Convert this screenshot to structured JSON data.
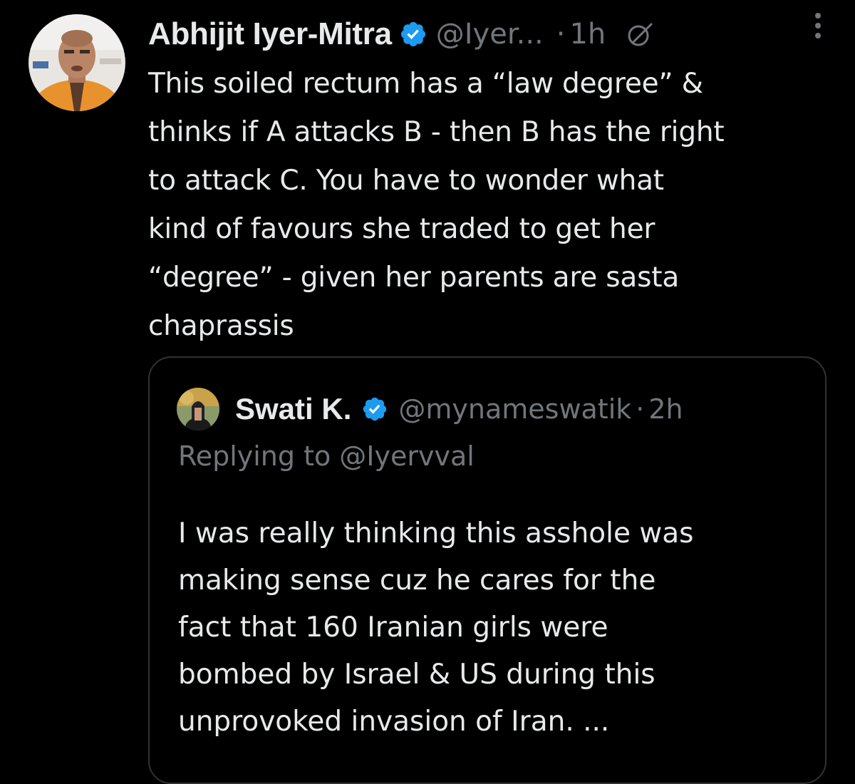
{
  "tweet": {
    "author": {
      "name": "Abhijit Iyer-Mitra",
      "handle": "@Iyer...",
      "verified": true
    },
    "separator": "·",
    "time": "1h",
    "icons": {
      "verified": "verified-badge-icon",
      "edit": "edit-history-icon",
      "more": "more-options-icon"
    },
    "text_lines": [
      "This soiled rectum has a “law degree” &",
      "thinks if A attacks B - then B has the right",
      "to attack C. You have to wonder what",
      "kind of favours she traded to get her",
      "“degree” - given her parents are sasta",
      "chaprassis"
    ]
  },
  "quoted_tweet": {
    "author": {
      "name": "Swati K.",
      "handle": "@mynameswatik",
      "verified": true
    },
    "separator": "·",
    "time": "2h",
    "replying_to": "Replying to @Iyervval",
    "text_lines": [
      "I was really thinking this asshole was",
      "making sense cuz he cares for the",
      "fact that 160 Iranian girls were",
      "bombed by Israel & US during this",
      "unprovoked invasion of Iran. ..."
    ]
  },
  "colors": {
    "background": "#000000",
    "primary_text": "#e7e9ea",
    "secondary_text": "#71767b",
    "verified_blue": "#1d9bf0",
    "card_border": "#2f3336"
  }
}
